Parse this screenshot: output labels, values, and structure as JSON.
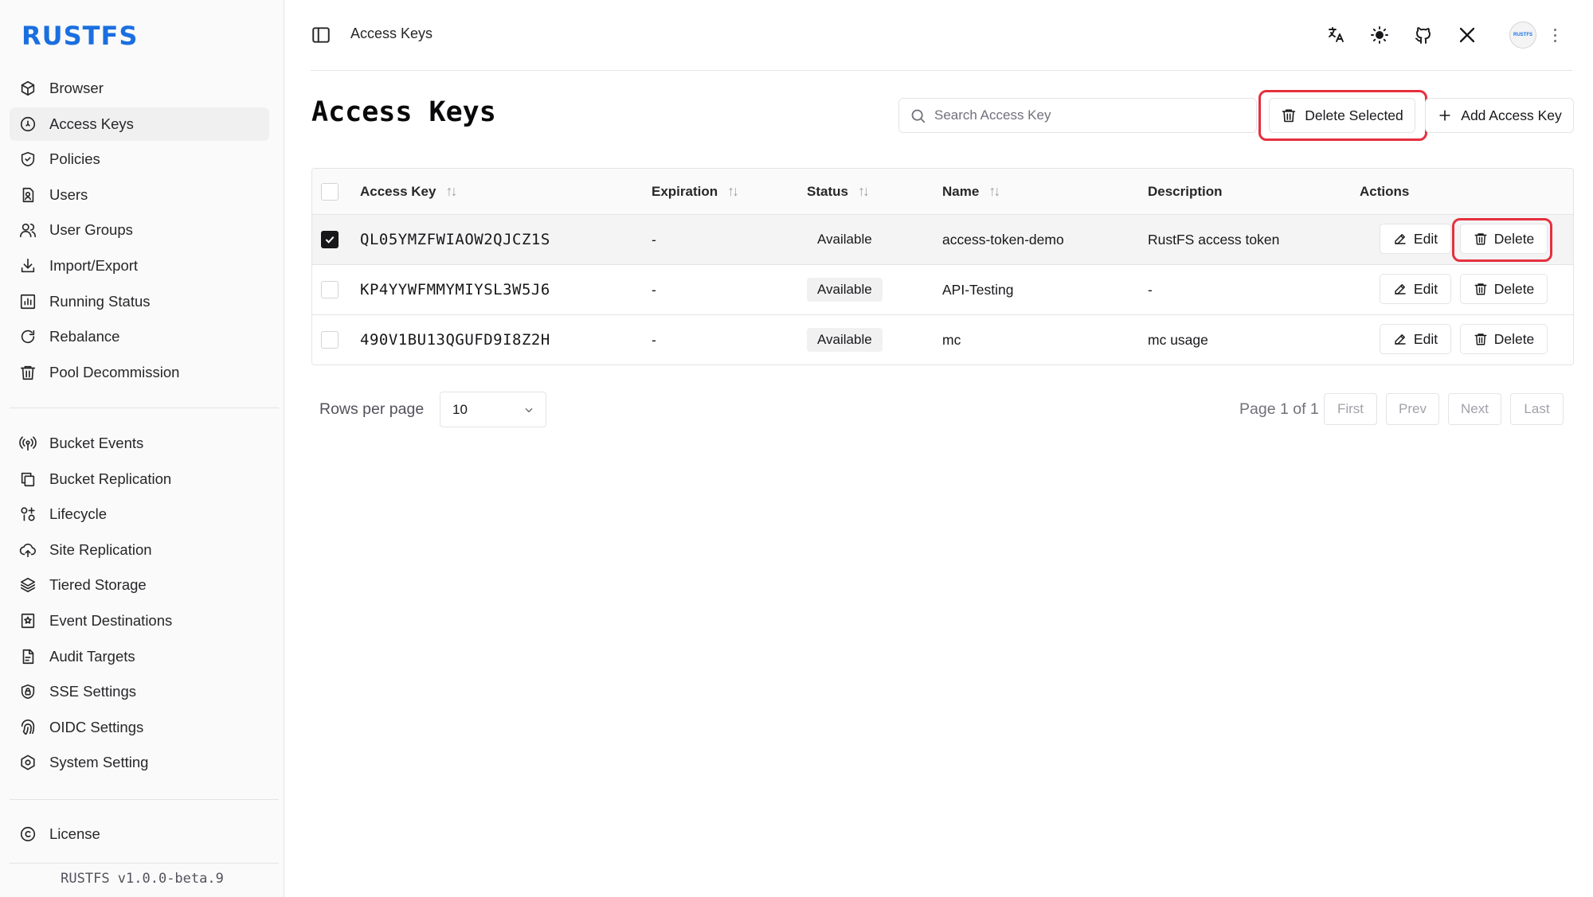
{
  "brand": {
    "logo": "RUSTFS",
    "version": "RUSTFS v1.0.0-beta.9"
  },
  "sidebar": {
    "groups": [
      [
        {
          "label": "Browser",
          "icon": "box-icon"
        },
        {
          "label": "Access Keys",
          "icon": "key-circle-icon",
          "active": true
        },
        {
          "label": "Policies",
          "icon": "shield-check-icon"
        },
        {
          "label": "Users",
          "icon": "user-file-icon"
        },
        {
          "label": "User Groups",
          "icon": "users-icon"
        },
        {
          "label": "Import/Export",
          "icon": "download-icon"
        },
        {
          "label": "Running Status",
          "icon": "bar-chart-icon"
        },
        {
          "label": "Rebalance",
          "icon": "refresh-icon"
        },
        {
          "label": "Pool Decommission",
          "icon": "trash-icon"
        }
      ],
      [
        {
          "label": "Bucket Events",
          "icon": "broadcast-icon"
        },
        {
          "label": "Bucket Replication",
          "icon": "copy-icon"
        },
        {
          "label": "Lifecycle",
          "icon": "cycle-icon"
        },
        {
          "label": "Site Replication",
          "icon": "cloud-upload-icon"
        },
        {
          "label": "Tiered Storage",
          "icon": "layers-icon"
        },
        {
          "label": "Event Destinations",
          "icon": "bookmark-star-icon"
        },
        {
          "label": "Audit Targets",
          "icon": "file-audit-icon"
        },
        {
          "label": "SSE Settings",
          "icon": "shield-lock-icon"
        },
        {
          "label": "OIDC Settings",
          "icon": "fingerprint-icon"
        },
        {
          "label": "System Setting",
          "icon": "settings-hexagon-icon"
        }
      ],
      [
        {
          "label": "License",
          "icon": "copyright-icon"
        }
      ]
    ]
  },
  "header": {
    "breadcrumb": "Access Keys",
    "avatar_text": "RUSTFS"
  },
  "page": {
    "title": "Access Keys",
    "search_placeholder": "Search Access Key",
    "delete_selected_label": "Delete Selected",
    "add_label": "Add Access Key"
  },
  "table": {
    "columns": [
      "Access Key",
      "Expiration",
      "Status",
      "Name",
      "Description",
      "Actions"
    ],
    "edit_label": "Edit",
    "delete_label": "Delete",
    "rows": [
      {
        "selected": true,
        "access_key": "QL05YMZFWIAOW2QJCZ1S",
        "expiration": "-",
        "status": "Available",
        "name": "access-token-demo",
        "description": "RustFS access token"
      },
      {
        "selected": false,
        "access_key": "KP4YYWFMMYMIYSL3W5J6",
        "expiration": "-",
        "status": "Available",
        "name": "API-Testing",
        "description": "-"
      },
      {
        "selected": false,
        "access_key": "490V1BU13QGUFD9I8Z2H",
        "expiration": "-",
        "status": "Available",
        "name": "mc",
        "description": "mc usage"
      }
    ]
  },
  "pagination": {
    "rows_per_page_label": "Rows per page",
    "rows_per_page_value": "10",
    "page_info": "Page 1 of 1",
    "buttons": [
      "First",
      "Prev",
      "Next",
      "Last"
    ]
  },
  "colors": {
    "brand": "#1a6fe0",
    "highlight": "#e5303e"
  }
}
